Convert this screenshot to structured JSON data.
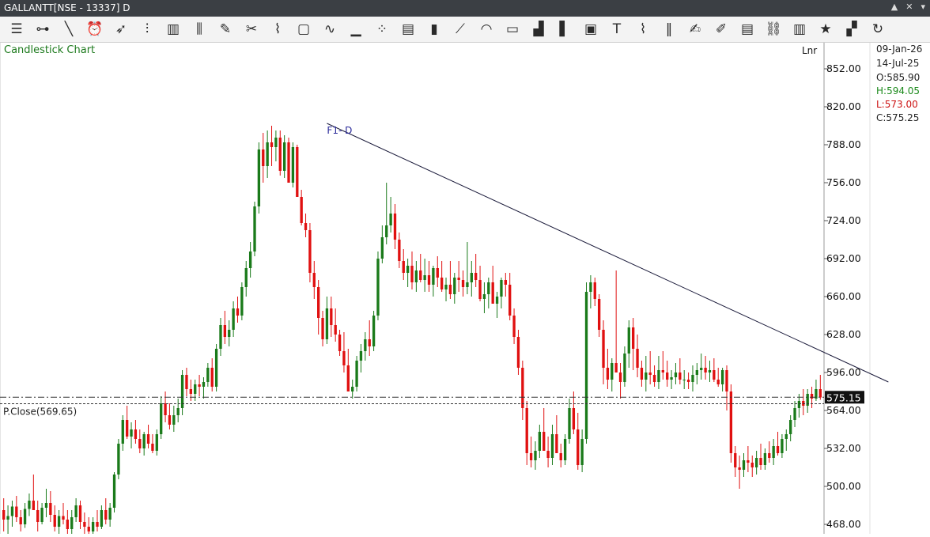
{
  "window": {
    "title": "GALLANTT[NSE - 13337] D",
    "controls": [
      "▲",
      "✕",
      "▾"
    ]
  },
  "toolbar": {
    "icons": [
      "menu-lines-icon",
      "line-tool-icon",
      "diagonal-line-icon",
      "alarm-icon",
      "cursor-pointer-icon",
      "bar-type-icon",
      "bar-chart-icon",
      "candlestick-icon",
      "pencil-icon",
      "scissors-icon",
      "node-edit-icon",
      "rectangle-icon",
      "curve-icon",
      "histogram-icon",
      "scatter-icon",
      "column-icon",
      "candles-colored-icon",
      "fan-lines-icon",
      "arc-icon",
      "ruler-icon",
      "volume-bars-icon",
      "vertical-bar-icon",
      "cube-icon",
      "text-tool-icon",
      "brush-icon",
      "pause-bars-icon",
      "hand-drawing-icon",
      "annotation-icon",
      "report-icon",
      "link-icon",
      "book-icon",
      "star-icon",
      "compare-icon",
      "refresh-icon"
    ]
  },
  "chart_data": {
    "type": "candlestick",
    "title": "Candlestick Chart",
    "scale_label": "Lnr",
    "trendline_label": "F1- D",
    "prev_close_label": "P.Close(569.65)",
    "prev_close": 569.65,
    "last_price_label": "575.15",
    "last_price": 575.15,
    "ylim": [
      460,
      874
    ],
    "yticks": [
      "852.00",
      "820.00",
      "788.00",
      "756.00",
      "724.00",
      "692.00",
      "660.00",
      "628.00",
      "596.00",
      "564.00",
      "532.00",
      "500.00",
      "468.00"
    ],
    "info": {
      "date_end": "09-Jan-26",
      "date_start": "14-Jul-25",
      "open": "O:585.90",
      "high": "H:594.05",
      "low": "L:573.00",
      "close": "C:575.25"
    },
    "trendline": {
      "from": [
        76,
        806
      ],
      "to": [
        208,
        588
      ]
    },
    "candles": [
      [
        480,
        490,
        462,
        472
      ],
      [
        472,
        484,
        458,
        475
      ],
      [
        475,
        488,
        466,
        483
      ],
      [
        483,
        492,
        470,
        474
      ],
      [
        474,
        480,
        462,
        468
      ],
      [
        468,
        486,
        465,
        481
      ],
      [
        481,
        494,
        475,
        488
      ],
      [
        488,
        510,
        480,
        480
      ],
      [
        480,
        488,
        462,
        470
      ],
      [
        470,
        486,
        468,
        482
      ],
      [
        482,
        498,
        474,
        486
      ],
      [
        486,
        496,
        470,
        476
      ],
      [
        476,
        484,
        462,
        466
      ],
      [
        466,
        480,
        460,
        475
      ],
      [
        475,
        486,
        468,
        472
      ],
      [
        472,
        480,
        456,
        464
      ],
      [
        464,
        480,
        458,
        474
      ],
      [
        474,
        490,
        470,
        484
      ],
      [
        484,
        488,
        464,
        470
      ],
      [
        470,
        478,
        460,
        466
      ],
      [
        466,
        474,
        456,
        462
      ],
      [
        462,
        474,
        458,
        470
      ],
      [
        470,
        480,
        462,
        466
      ],
      [
        466,
        484,
        464,
        480
      ],
      [
        480,
        490,
        468,
        472
      ],
      [
        472,
        486,
        466,
        482
      ],
      [
        482,
        512,
        478,
        510
      ],
      [
        510,
        540,
        506,
        536
      ],
      [
        536,
        560,
        530,
        556
      ],
      [
        556,
        568,
        540,
        542
      ],
      [
        542,
        554,
        532,
        548
      ],
      [
        548,
        556,
        536,
        540
      ],
      [
        540,
        548,
        528,
        532
      ],
      [
        532,
        546,
        526,
        544
      ],
      [
        544,
        552,
        532,
        536
      ],
      [
        536,
        544,
        528,
        530
      ],
      [
        530,
        548,
        526,
        544
      ],
      [
        544,
        576,
        540,
        570
      ],
      [
        570,
        580,
        554,
        560
      ],
      [
        560,
        570,
        548,
        552
      ],
      [
        552,
        568,
        546,
        560
      ],
      [
        560,
        574,
        554,
        566
      ],
      [
        566,
        598,
        560,
        594
      ],
      [
        594,
        600,
        576,
        582
      ],
      [
        582,
        590,
        572,
        578
      ],
      [
        578,
        590,
        572,
        586
      ],
      [
        586,
        594,
        576,
        584
      ],
      [
        584,
        592,
        574,
        588
      ],
      [
        588,
        604,
        584,
        600
      ],
      [
        600,
        608,
        580,
        584
      ],
      [
        584,
        620,
        580,
        616
      ],
      [
        616,
        642,
        610,
        636
      ],
      [
        636,
        648,
        620,
        626
      ],
      [
        626,
        640,
        618,
        632
      ],
      [
        632,
        656,
        626,
        650
      ],
      [
        650,
        660,
        638,
        644
      ],
      [
        644,
        672,
        640,
        668
      ],
      [
        668,
        690,
        660,
        684
      ],
      [
        684,
        706,
        676,
        698
      ],
      [
        698,
        740,
        694,
        736
      ],
      [
        736,
        790,
        730,
        784
      ],
      [
        784,
        798,
        756,
        770
      ],
      [
        770,
        800,
        760,
        790
      ],
      [
        790,
        804,
        770,
        786
      ],
      [
        786,
        800,
        774,
        794
      ],
      [
        794,
        800,
        762,
        766
      ],
      [
        766,
        796,
        760,
        790
      ],
      [
        790,
        794,
        760,
        756
      ],
      [
        756,
        790,
        752,
        786
      ],
      [
        786,
        788,
        752,
        744
      ],
      [
        744,
        750,
        720,
        722
      ],
      [
        722,
        730,
        710,
        716
      ],
      [
        716,
        722,
        672,
        680
      ],
      [
        680,
        690,
        658,
        668
      ],
      [
        668,
        674,
        628,
        642
      ],
      [
        642,
        648,
        618,
        624
      ],
      [
        624,
        660,
        620,
        650
      ],
      [
        650,
        660,
        626,
        636
      ],
      [
        636,
        650,
        622,
        628
      ],
      [
        628,
        632,
        610,
        614
      ],
      [
        614,
        630,
        596,
        602
      ],
      [
        602,
        616,
        586,
        580
      ],
      [
        580,
        590,
        574,
        584
      ],
      [
        584,
        610,
        580,
        606
      ],
      [
        606,
        620,
        596,
        614
      ],
      [
        614,
        630,
        606,
        624
      ],
      [
        624,
        640,
        610,
        618
      ],
      [
        618,
        648,
        614,
        644
      ],
      [
        644,
        698,
        640,
        692
      ],
      [
        692,
        720,
        688,
        710
      ],
      [
        710,
        756,
        704,
        720
      ],
      [
        720,
        744,
        714,
        730
      ],
      [
        730,
        738,
        700,
        708
      ],
      [
        708,
        714,
        684,
        690
      ],
      [
        690,
        700,
        674,
        680
      ],
      [
        680,
        692,
        668,
        686
      ],
      [
        686,
        698,
        666,
        672
      ],
      [
        672,
        690,
        664,
        682
      ],
      [
        682,
        696,
        672,
        674
      ],
      [
        674,
        692,
        664,
        678
      ],
      [
        678,
        690,
        664,
        670
      ],
      [
        670,
        686,
        660,
        684
      ],
      [
        684,
        694,
        668,
        676
      ],
      [
        676,
        690,
        664,
        666
      ],
      [
        666,
        676,
        656,
        670
      ],
      [
        670,
        690,
        658,
        662
      ],
      [
        662,
        680,
        654,
        676
      ],
      [
        676,
        690,
        664,
        674
      ],
      [
        674,
        682,
        660,
        668
      ],
      [
        668,
        706,
        662,
        672
      ],
      [
        672,
        690,
        660,
        680
      ],
      [
        680,
        696,
        668,
        674
      ],
      [
        674,
        686,
        656,
        658
      ],
      [
        658,
        672,
        646,
        662
      ],
      [
        662,
        676,
        650,
        672
      ],
      [
        672,
        686,
        660,
        654
      ],
      [
        654,
        664,
        642,
        660
      ],
      [
        660,
        676,
        650,
        674
      ],
      [
        674,
        680,
        660,
        670
      ],
      [
        670,
        680,
        640,
        644
      ],
      [
        644,
        650,
        620,
        626
      ],
      [
        626,
        632,
        594,
        600
      ],
      [
        600,
        606,
        556,
        566
      ],
      [
        566,
        572,
        518,
        528
      ],
      [
        528,
        542,
        516,
        522
      ],
      [
        522,
        538,
        514,
        530
      ],
      [
        530,
        552,
        524,
        546
      ],
      [
        546,
        566,
        536,
        530
      ],
      [
        530,
        542,
        516,
        524
      ],
      [
        524,
        552,
        518,
        544
      ],
      [
        544,
        560,
        536,
        528
      ],
      [
        528,
        536,
        516,
        522
      ],
      [
        522,
        544,
        518,
        540
      ],
      [
        540,
        574,
        536,
        566
      ],
      [
        566,
        580,
        544,
        548
      ],
      [
        548,
        562,
        514,
        518
      ],
      [
        518,
        548,
        512,
        540
      ],
      [
        540,
        672,
        536,
        664
      ],
      [
        664,
        678,
        650,
        672
      ],
      [
        672,
        676,
        652,
        658
      ],
      [
        658,
        662,
        626,
        632
      ],
      [
        632,
        640,
        586,
        600
      ],
      [
        600,
        616,
        582,
        590
      ],
      [
        590,
        608,
        580,
        604
      ],
      [
        604,
        682,
        600,
        596
      ],
      [
        596,
        604,
        574,
        588
      ],
      [
        588,
        618,
        584,
        612
      ],
      [
        612,
        640,
        600,
        634
      ],
      [
        634,
        642,
        598,
        616
      ],
      [
        616,
        628,
        592,
        600
      ],
      [
        600,
        606,
        584,
        590
      ],
      [
        590,
        610,
        580,
        596
      ],
      [
        596,
        614,
        586,
        594
      ],
      [
        594,
        602,
        584,
        588
      ],
      [
        588,
        610,
        582,
        598
      ],
      [
        598,
        614,
        590,
        596
      ],
      [
        596,
        606,
        584,
        590
      ],
      [
        590,
        598,
        582,
        592
      ],
      [
        592,
        604,
        586,
        596
      ],
      [
        596,
        608,
        586,
        590
      ],
      [
        590,
        598,
        582,
        590
      ],
      [
        590,
        596,
        582,
        588
      ],
      [
        588,
        602,
        580,
        594
      ],
      [
        594,
        604,
        586,
        598
      ],
      [
        598,
        612,
        590,
        600
      ],
      [
        600,
        610,
        590,
        596
      ],
      [
        596,
        606,
        588,
        598
      ],
      [
        598,
        608,
        588,
        590
      ],
      [
        590,
        600,
        584,
        586
      ],
      [
        586,
        600,
        580,
        598
      ],
      [
        598,
        602,
        564,
        580
      ],
      [
        580,
        586,
        520,
        528
      ],
      [
        528,
        534,
        508,
        516
      ],
      [
        516,
        526,
        498,
        514
      ],
      [
        514,
        528,
        508,
        522
      ],
      [
        522,
        534,
        512,
        520
      ],
      [
        520,
        526,
        508,
        516
      ],
      [
        516,
        530,
        510,
        524
      ],
      [
        524,
        536,
        514,
        518
      ],
      [
        518,
        532,
        514,
        528
      ],
      [
        528,
        538,
        520,
        524
      ],
      [
        524,
        540,
        518,
        534
      ],
      [
        534,
        546,
        526,
        528
      ],
      [
        528,
        544,
        524,
        540
      ],
      [
        540,
        548,
        530,
        544
      ],
      [
        544,
        560,
        538,
        556
      ],
      [
        556,
        572,
        550,
        566
      ],
      [
        566,
        578,
        558,
        572
      ],
      [
        572,
        582,
        560,
        568
      ],
      [
        568,
        582,
        562,
        578
      ],
      [
        578,
        584,
        566,
        574
      ],
      [
        574,
        590,
        572,
        582
      ],
      [
        582,
        594,
        573,
        575
      ]
    ]
  }
}
